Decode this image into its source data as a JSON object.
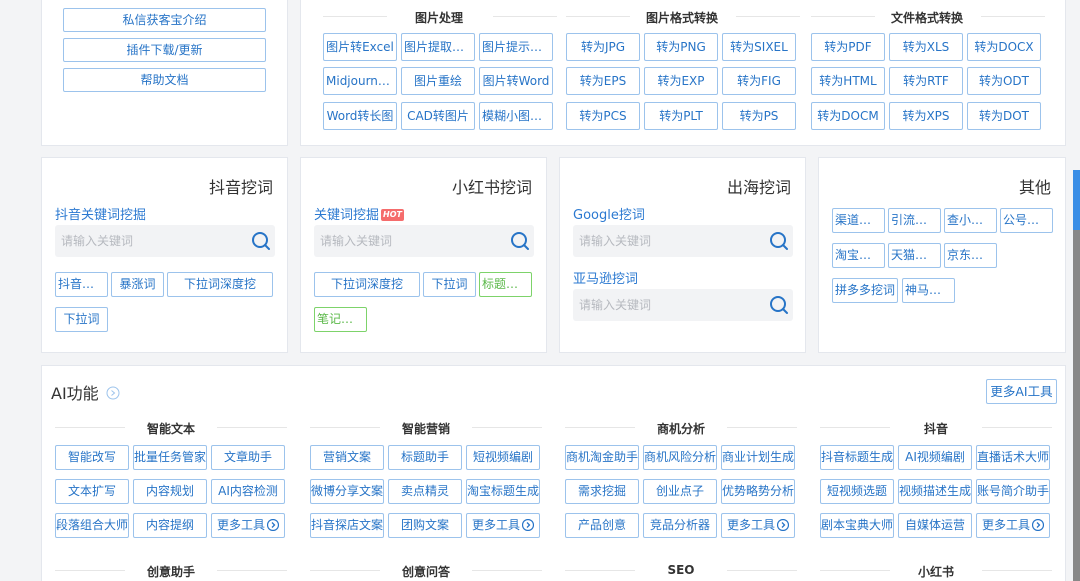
{
  "top_left": {
    "links": [
      "私信获客宝介绍",
      "插件下载/更新",
      "帮助文档"
    ]
  },
  "image_tools": {
    "groups": [
      {
        "title": "图片处理",
        "items": [
          "图片转Excel",
          "图片提取文字",
          "图片提示词...",
          "Midjourney...",
          "图片重绘",
          "图片转Word",
          "Word转长图",
          "CAD转图片",
          "模糊小图变..."
        ]
      },
      {
        "title": "图片格式转换",
        "items": [
          "转为JPG",
          "转为PNG",
          "转为SIXEL",
          "转为EPS",
          "转为EXP",
          "转为FIG",
          "转为PCS",
          "转为PLT",
          "转为PS"
        ]
      },
      {
        "title": "文件格式转换",
        "items": [
          "转为PDF",
          "转为XLS",
          "转为DOCX",
          "转为HTML",
          "转为RTF",
          "转为ODT",
          "转为DOCM",
          "转为XPS",
          "转为DOT"
        ]
      }
    ]
  },
  "douyin": {
    "title": "抖音挖词",
    "link": "抖音关键词挖掘",
    "placeholder": "请输入关键词",
    "buttons": [
      "抖音热词",
      "暴涨词",
      "下拉词深度挖",
      "下拉词"
    ]
  },
  "xiaohongshu": {
    "title": "小红书挖词",
    "link": "关键词挖掘",
    "hot": "HOT",
    "placeholder": "请输入关键词",
    "buttons": [
      "下拉词深度挖",
      "下拉词"
    ],
    "green_buttons": [
      "标题生成",
      "笔记生成"
    ]
  },
  "overseas": {
    "title": "出海挖词",
    "google_link": "Google挖词",
    "google_placeholder": "请输入关键词",
    "amazon_link": "亚马逊挖词",
    "amazon_placeholder": "请输入关键词"
  },
  "other": {
    "title": "其他",
    "buttons": [
      "渠道挖掘",
      "引流网站",
      "查小程序",
      "公号截流",
      "淘宝挖词",
      "天猫挖词",
      "京东挖词",
      "拼多多挖词",
      "神马挖词"
    ]
  },
  "ai": {
    "title": "AI功能",
    "more_button": "更多AI工具",
    "groups": [
      {
        "title": "智能文本",
        "items": [
          "智能改写",
          "批量任务管家",
          "文章助手",
          "文本扩写",
          "内容规划",
          "AI内容检测",
          "段落组合大师",
          "内容提纲",
          "更多工具"
        ]
      },
      {
        "title": "智能营销",
        "items": [
          "营销文案",
          "标题助手",
          "短视频编剧",
          "微博分享文案",
          "卖点精灵",
          "淘宝标题生成",
          "抖音探店文案",
          "团购文案",
          "更多工具"
        ]
      },
      {
        "title": "商机分析",
        "items": [
          "商机淘金助手",
          "商机风险分析",
          "商业计划生成",
          "需求挖掘",
          "创业点子",
          "优势略势分析",
          "产品创意",
          "竞品分析器",
          "更多工具"
        ]
      },
      {
        "title": "抖音",
        "items": [
          "抖音标题生成",
          "AI视频编剧",
          "直播话术大师",
          "短视频选题",
          "视频描述生成",
          "账号简介助手",
          "剧本宝典大师",
          "自媒体运营",
          "更多工具"
        ]
      }
    ],
    "bottom_titles": [
      "创意助手",
      "创意问答",
      "SEO",
      "小红书"
    ]
  }
}
